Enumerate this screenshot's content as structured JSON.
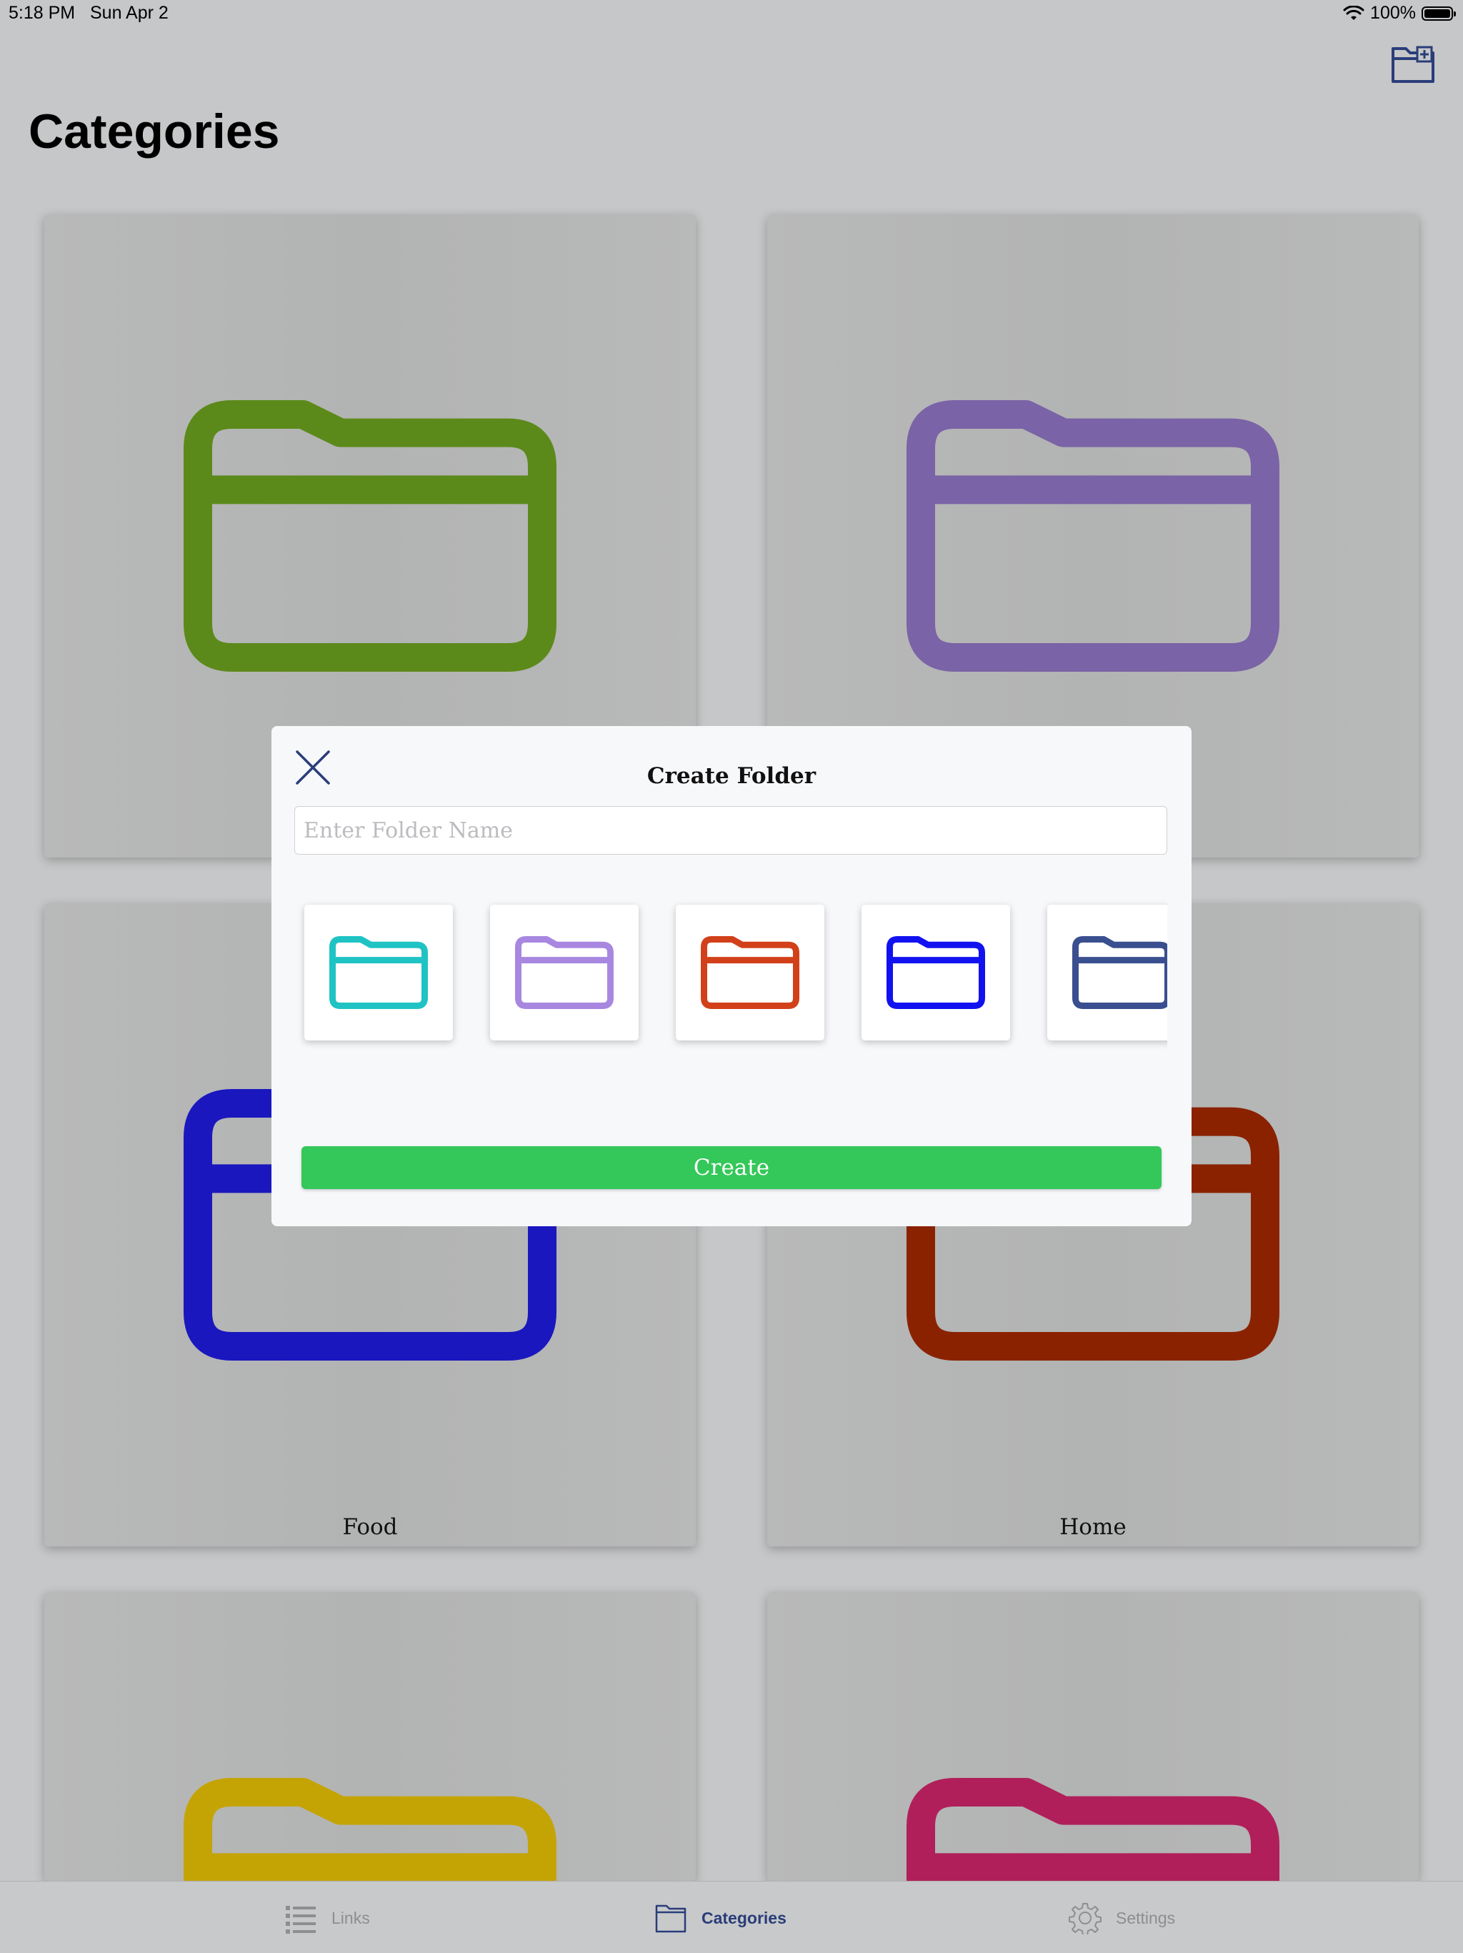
{
  "status_bar": {
    "time": "5:18 PM",
    "date": "Sun Apr 2",
    "battery": "100%"
  },
  "header": {
    "title": "Categories"
  },
  "categories": [
    {
      "label": "",
      "color": "#5c8a1a"
    },
    {
      "label": "",
      "color": "#7a63a6"
    },
    {
      "label": "Food",
      "color": "#1a17bf"
    },
    {
      "label": "Home",
      "color": "#8a2200"
    },
    {
      "label": "",
      "color": "#c4a405"
    },
    {
      "label": "",
      "color": "#b01f5a"
    }
  ],
  "modal": {
    "title": "Create Folder",
    "input_placeholder": "Enter Folder Name",
    "input_value": "",
    "create_label": "Create",
    "swatches": [
      {
        "color": "#1fc3c4"
      },
      {
        "color": "#a887e0"
      },
      {
        "color": "#d2401a"
      },
      {
        "color": "#1212f0"
      },
      {
        "color": "#3a4f8f"
      }
    ]
  },
  "tabbar": {
    "tabs": [
      {
        "label": "Links",
        "icon": "list-icon"
      },
      {
        "label": "Categories",
        "icon": "folder-icon"
      },
      {
        "label": "Settings",
        "icon": "gear-icon"
      }
    ],
    "active_color": "#2a3d7a"
  },
  "accent": "#2a3d7a"
}
